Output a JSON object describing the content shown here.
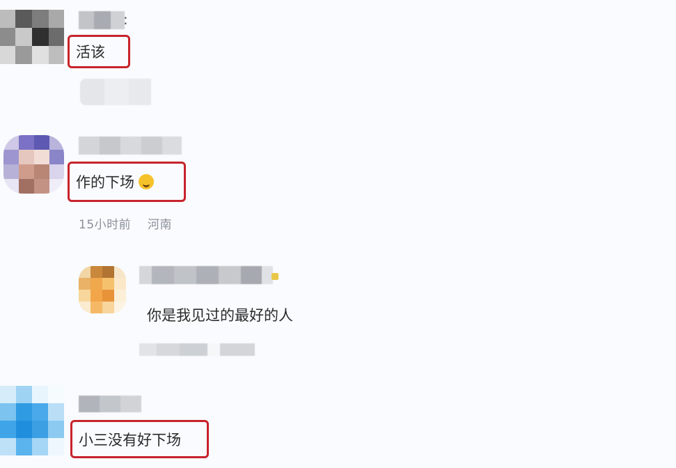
{
  "comments": [
    {
      "text": "活该",
      "avatar_icon": "pixelated-avatar-gray"
    },
    {
      "text": "作的下场",
      "emoji": "rolling-laughing-emoji",
      "time": "15小时前",
      "location": "河南",
      "avatar_icon": "pixelated-avatar-purple",
      "reply": {
        "text": "你是我见过的最好的人",
        "avatar_icon": "pixelated-avatar-orange"
      }
    },
    {
      "text": "小三没有好下场",
      "avatar_icon": "pixelated-avatar-blue"
    }
  ],
  "colors": {
    "highlight_border": "#c8232c",
    "background": "#f9fbfe",
    "meta_text": "#8a8f99"
  }
}
